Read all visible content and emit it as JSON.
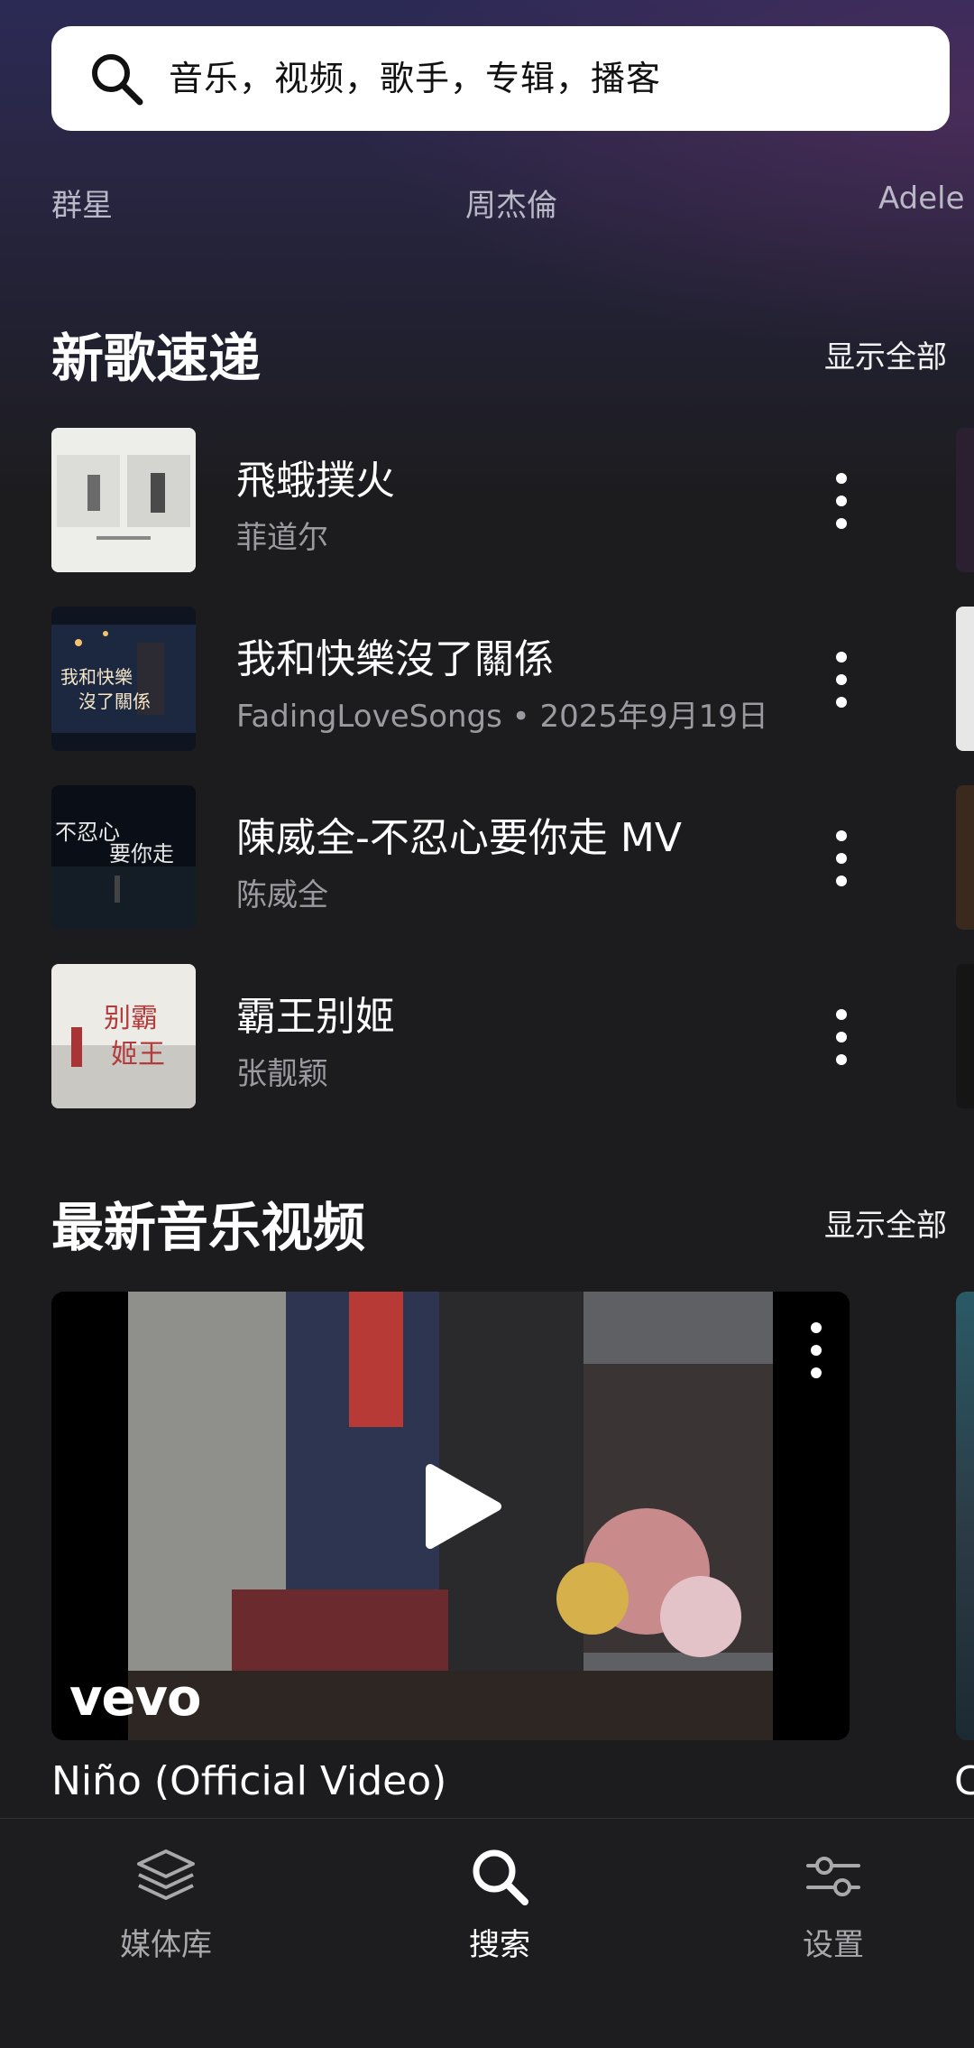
{
  "search": {
    "placeholder": "音乐，视频，歌手，专辑，播客"
  },
  "artists": [
    "群星",
    "周杰倫",
    "Adele"
  ],
  "new_songs": {
    "title": "新歌速递",
    "show_all": "显示全部",
    "items": [
      {
        "title": "飛蛾撲火",
        "subtitle": "菲道尔"
      },
      {
        "title": "我和快樂沒了關係",
        "subtitle": "FadingLoveSongs • 2025年9月19日"
      },
      {
        "title": "陳威全-不忍心要你走 MV",
        "subtitle": "陈威全"
      },
      {
        "title": "霸王别姬",
        "subtitle": "张靓颖"
      }
    ]
  },
  "videos": {
    "title": "最新音乐视频",
    "show_all": "显示全部",
    "items": [
      {
        "title": "Niño (Official Video)",
        "brand": "vevo"
      }
    ],
    "peek_title": "C"
  },
  "tabbar": {
    "items": [
      {
        "label": "媒体库",
        "icon": "layers-icon",
        "active": false
      },
      {
        "label": "搜索",
        "icon": "search-icon",
        "active": true
      },
      {
        "label": "设置",
        "icon": "sliders-icon",
        "active": false
      }
    ]
  },
  "colors": {
    "accent_active": "#ffffff",
    "inactive": "#a8a8ad",
    "subtitle": "#9a9aa0",
    "background": "#1c1c1e"
  }
}
